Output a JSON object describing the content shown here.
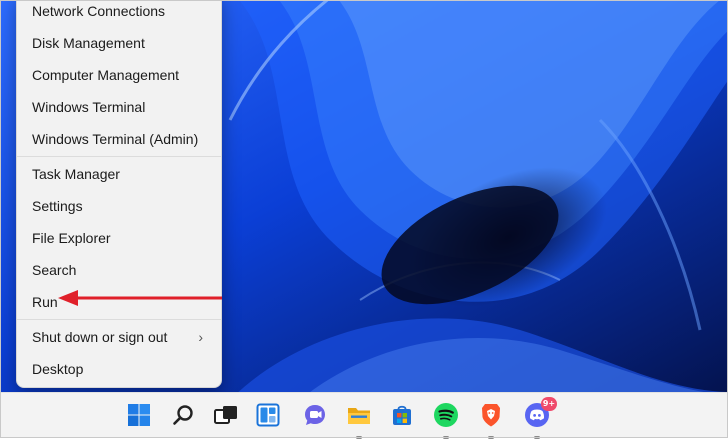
{
  "menu": {
    "items": [
      {
        "label": "Network Connections"
      },
      {
        "label": "Disk Management"
      },
      {
        "label": "Computer Management"
      },
      {
        "label": "Windows Terminal"
      },
      {
        "label": "Windows Terminal (Admin)"
      },
      {
        "label": "Task Manager"
      },
      {
        "label": "Settings"
      },
      {
        "label": "File Explorer"
      },
      {
        "label": "Search"
      },
      {
        "label": "Run"
      },
      {
        "label": "Shut down or sign out",
        "has_submenu": true
      },
      {
        "label": "Desktop"
      }
    ],
    "submenu_glyph": "›"
  },
  "annotation": {
    "points_to": "Run",
    "color": "#e0202a"
  },
  "taskbar": {
    "icons": [
      "windows-start-icon",
      "search-icon",
      "task-view-icon",
      "widgets-icon",
      "teams-chat-icon",
      "file-explorer-icon",
      "microsoft-store-icon",
      "spotify-icon",
      "brave-browser-icon",
      "discord-icon"
    ],
    "discord_badge": "9+"
  },
  "colors": {
    "wallpaper": "#0a2a8a",
    "accent": "#0067c0",
    "menu_bg": "#f2f2f2",
    "taskbar_bg": "#f3f3f3"
  }
}
